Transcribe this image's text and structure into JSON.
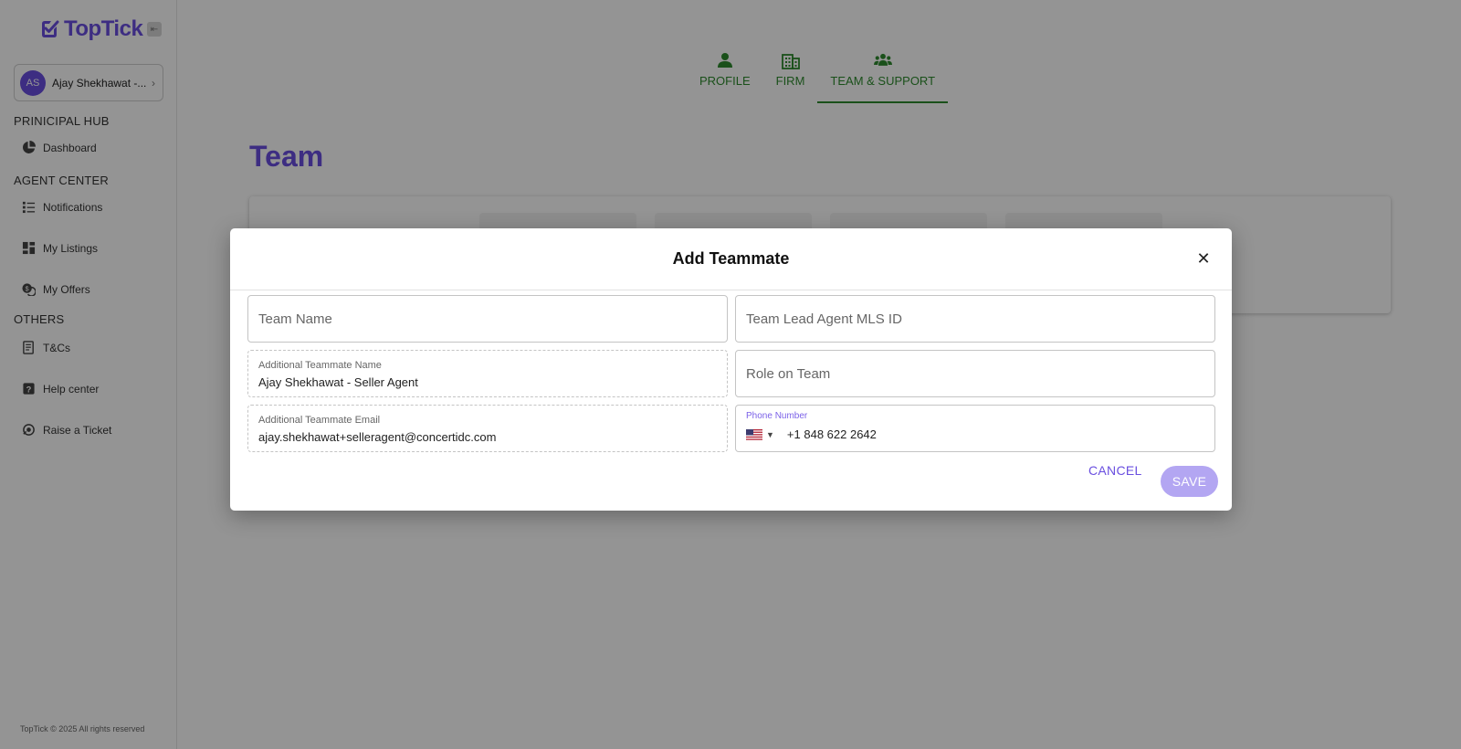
{
  "brand": {
    "name": "TopTick",
    "accent": "#6a4fe0"
  },
  "user": {
    "initials": "AS",
    "name": "Ajay Shekhawat -..."
  },
  "sidebar": {
    "sections": [
      {
        "title": "PRINICIPAL HUB"
      },
      {
        "title": "AGENT CENTER"
      },
      {
        "title": "OTHERS"
      }
    ],
    "items": [
      {
        "label": "Dashboard",
        "icon": "pie-chart-icon"
      },
      {
        "label": "Notifications",
        "icon": "list-icon"
      },
      {
        "label": "My Listings",
        "icon": "grid-icon"
      },
      {
        "label": "My Offers",
        "icon": "offers-icon"
      },
      {
        "label": "T&Cs",
        "icon": "document-icon"
      },
      {
        "label": "Help center",
        "icon": "help-icon"
      },
      {
        "label": "Raise a Ticket",
        "icon": "ticket-icon"
      }
    ],
    "footer": "TopTick © 2025 All rights reserved"
  },
  "tabs": [
    {
      "label": "PROFILE",
      "icon": "person-icon"
    },
    {
      "label": "FIRM",
      "icon": "building-icon"
    },
    {
      "label": "TEAM & SUPPORT",
      "icon": "group-icon",
      "active": true
    }
  ],
  "page": {
    "title": "Team"
  },
  "modal": {
    "title": "Add Teammate",
    "fields": {
      "team_name": {
        "placeholder": "Team Name"
      },
      "team_lead_mls": {
        "placeholder": "Team Lead Agent MLS ID"
      },
      "teammate_name": {
        "label": "Additional Teammate Name",
        "value": "Ajay  Shekhawat - Seller Agent"
      },
      "role": {
        "placeholder": "Role on Team"
      },
      "teammate_email": {
        "label": "Additional Teammate Email",
        "value": "ajay.shekhawat+selleragent@concertidc.com"
      },
      "phone": {
        "label": "Phone Number",
        "value": "+1 848 622 2642",
        "country_icon": "us-flag-icon"
      }
    },
    "cancel_label": "CANCEL",
    "save_label": "SAVE"
  }
}
